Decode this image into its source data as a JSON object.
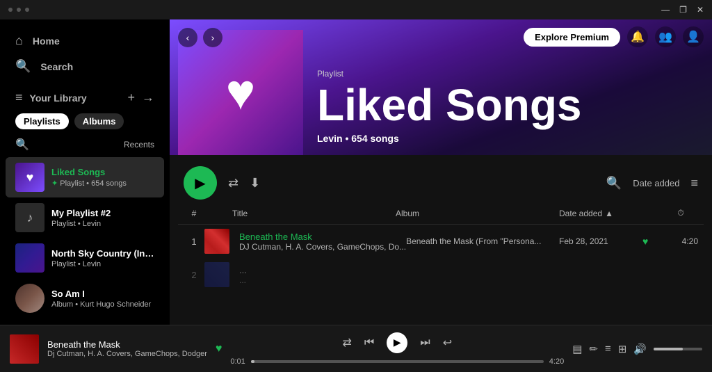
{
  "titlebar": {
    "controls": [
      "—",
      "❐",
      "✕"
    ]
  },
  "sidebar": {
    "nav": [
      {
        "id": "home",
        "label": "Home",
        "icon": "⌂"
      },
      {
        "id": "search",
        "label": "Search",
        "icon": "🔍"
      }
    ],
    "library": {
      "title": "Your Library",
      "filters": [
        {
          "label": "Playlists",
          "active": true
        },
        {
          "label": "Albums",
          "active": false
        }
      ],
      "recents_label": "Recents",
      "items": [
        {
          "id": "liked-songs",
          "name": "Liked Songs",
          "sub": "Playlist • 654 songs",
          "type": "liked",
          "active": true
        },
        {
          "id": "my-playlist-2",
          "name": "My Playlist #2",
          "sub": "Playlist • Levin",
          "type": "playlist"
        },
        {
          "id": "north-sky-country",
          "name": "North Sky Country (In-Game)",
          "sub": "Playlist • Levin",
          "type": "playlist-img"
        },
        {
          "id": "so-am-i",
          "name": "So Am I",
          "sub": "Album • Kurt Hugo Schneider",
          "type": "album-img"
        }
      ]
    }
  },
  "hero": {
    "type_label": "Playlist",
    "title": "Liked Songs",
    "user": "Levin",
    "song_count": "654 songs",
    "explore_btn": "Explore Premium"
  },
  "controls": {
    "sort_label": "Date added"
  },
  "table": {
    "headers": {
      "num": "#",
      "title": "Title",
      "album": "Album",
      "date_added": "Date added",
      "duration": "⏱"
    },
    "tracks": [
      {
        "num": "1",
        "name": "Beneath the Mask",
        "artist": "DJ Cutman, H. A. Covers, GameChops, Do...",
        "album": "Beneath the Mask (From \"Persona...",
        "date": "Feb 28, 2021",
        "liked": true,
        "duration": "4:20"
      },
      {
        "num": "2",
        "name": "...",
        "artist": "...",
        "album": "...",
        "date": "",
        "liked": false,
        "duration": ""
      }
    ]
  },
  "player": {
    "track_name": "Beneath the Mask",
    "track_artist": "Dj Cutman, H. A. Covers, GameChops, Dodger",
    "current_time": "0:01",
    "total_time": "4:20",
    "volume_pct": 60
  }
}
